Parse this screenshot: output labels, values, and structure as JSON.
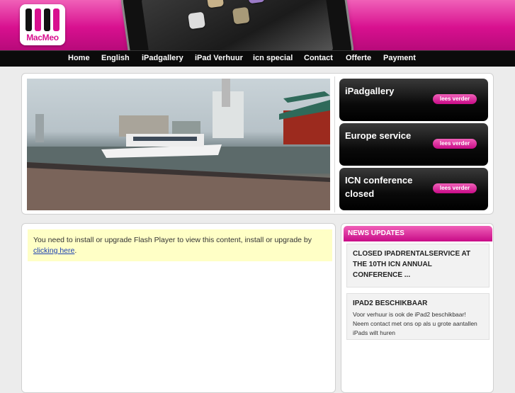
{
  "brand": {
    "logo_text": "MacMeo",
    "accent": "#d8108f"
  },
  "nav": {
    "items": [
      {
        "label": "Home"
      },
      {
        "label": "English"
      },
      {
        "label": "iPadgallery"
      },
      {
        "label": "iPad Verhuur"
      },
      {
        "label": "icn special"
      },
      {
        "label": "Contact"
      },
      {
        "label": "Offerte"
      },
      {
        "label": "Payment"
      }
    ]
  },
  "promos": [
    {
      "title": "iPadgallery",
      "button": "lees verder"
    },
    {
      "title": "Europe service",
      "button": "lees verder"
    },
    {
      "title": "ICN conference closed",
      "button": "lees verder"
    }
  ],
  "flash_notice": {
    "text": "You need to install or upgrade Flash Player to view this content, install or upgrade by ",
    "link": "clicking here",
    "suffix": "."
  },
  "news": {
    "header": "NEWS UPDATES",
    "items": [
      {
        "title": "CLOSED IPADRENTALSERVICE AT THE 10TH ICN ANNUAL CONFERENCE ..."
      },
      {
        "title": "IPAD2 BESCHIKBAAR",
        "body": "Voor verhuur is ook de iPad2 beschikbaar! Neem contact met ons op als u grote aantallen iPads wilt huren"
      }
    ]
  }
}
